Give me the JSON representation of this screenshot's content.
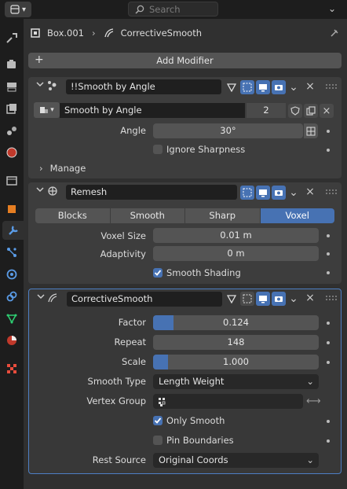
{
  "header": {
    "search_placeholder": "Search",
    "object_name": "Box.001",
    "modifier_name": "CorrectiveSmooth"
  },
  "add_modifier": {
    "label": "Add Modifier"
  },
  "modifiers": {
    "smooth_by_angle": {
      "name": "!!Smooth by Angle",
      "node_group": "Smooth by Angle",
      "users": "2",
      "angle_label": "Angle",
      "angle_value": "30°",
      "ignore_sharpness_label": "Ignore Sharpness",
      "ignore_sharpness": false,
      "manage_label": "Manage"
    },
    "remesh": {
      "name": "Remesh",
      "modes": [
        "Blocks",
        "Smooth",
        "Sharp",
        "Voxel"
      ],
      "selected_mode": "Voxel",
      "voxel_size_label": "Voxel Size",
      "voxel_size_value": "0.01 m",
      "adaptivity_label": "Adaptivity",
      "adaptivity_value": "0 m",
      "smooth_shading_label": "Smooth Shading",
      "smooth_shading": true
    },
    "corrective_smooth": {
      "name": "CorrectiveSmooth",
      "factor_label": "Factor",
      "factor_value": "0.124",
      "factor_fraction": 0.124,
      "repeat_label": "Repeat",
      "repeat_value": "148",
      "scale_label": "Scale",
      "scale_value": "1.000",
      "scale_fraction": 0.09,
      "smooth_type_label": "Smooth Type",
      "smooth_type_value": "Length Weight",
      "vertex_group_label": "Vertex Group",
      "vertex_group_value": "",
      "only_smooth_label": "Only Smooth",
      "only_smooth": true,
      "pin_boundaries_label": "Pin Boundaries",
      "pin_boundaries": false,
      "rest_source_label": "Rest Source",
      "rest_source_value": "Original Coords"
    }
  },
  "colors": {
    "accent": "#4772b3",
    "panel": "#3d3d3d",
    "background": "#303030",
    "field": "#545454",
    "active_border": "#4d7fc5"
  },
  "icons": {
    "sidebar": [
      "tool-icon",
      "render-icon",
      "output-icon",
      "view-layer-icon",
      "scene-icon",
      "world-icon",
      "collection-icon",
      "object-icon",
      "modifiers-icon",
      "particles-icon",
      "physics-icon",
      "constraints-icon",
      "data-icon",
      "material-icon",
      "texture-icon"
    ]
  }
}
